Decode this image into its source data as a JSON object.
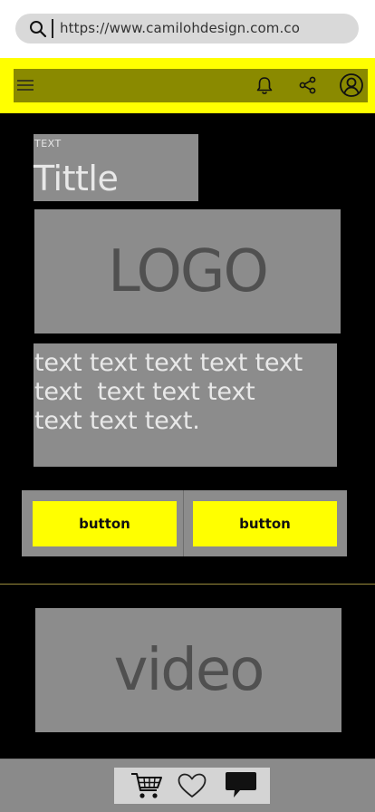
{
  "browser": {
    "url": "https://www.camilohdesign.com.co",
    "icons": {
      "search": "search-icon"
    }
  },
  "header": {
    "icons": [
      "menu-icon",
      "bell-icon",
      "share-icon",
      "account-icon"
    ]
  },
  "hero": {
    "kicker": "TEXT",
    "title": "Tittle",
    "logo": "LOGO",
    "body": "text text text text text\ntext  text text text\ntext text text."
  },
  "buttons": {
    "left_label": "button",
    "right_label": "button"
  },
  "media": {
    "video_label": "video"
  },
  "bottom_nav": {
    "icons": [
      "cart-icon",
      "heart-icon",
      "chat-icon"
    ]
  },
  "colors": {
    "accent": "#ffff00",
    "header_inner": "#8a8a00",
    "background": "#000000",
    "placeholder": "#8c8c8c"
  }
}
